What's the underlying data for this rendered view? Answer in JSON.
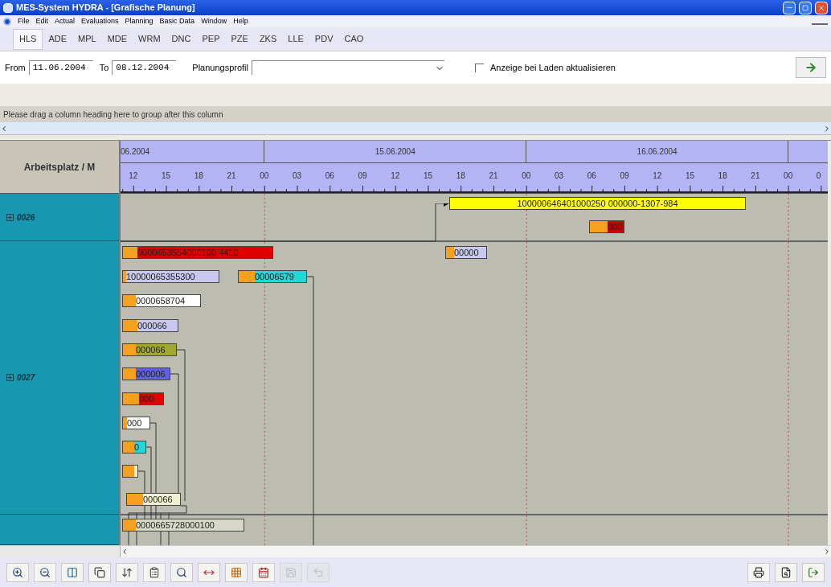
{
  "window": {
    "title": "MES-System HYDRA - [Grafische Planung]"
  },
  "menu": [
    "File",
    "Edit",
    "Actual",
    "Evaluations",
    "Planning",
    "Basic Data",
    "Window",
    "Help"
  ],
  "modules": [
    {
      "label": "HLS",
      "selected": true
    },
    {
      "label": "ADE",
      "selected": false
    },
    {
      "label": "MPL",
      "selected": false
    },
    {
      "label": "MDE",
      "selected": false
    },
    {
      "label": "WRM",
      "selected": false
    },
    {
      "label": "DNC",
      "selected": false
    },
    {
      "label": "PEP",
      "selected": false
    },
    {
      "label": "PZE",
      "selected": false
    },
    {
      "label": "ZKS",
      "selected": false
    },
    {
      "label": "LLE",
      "selected": false
    },
    {
      "label": "PDV",
      "selected": false
    },
    {
      "label": "CAO",
      "selected": false
    }
  ],
  "filter": {
    "from_label": "From",
    "from": "11.06.2004",
    "to_label": "To",
    "to": "08.12.2004",
    "profile_label": "Planungsprofil",
    "refresh": {
      "label": "Anzeige bei Laden aktualisieren",
      "checked": false
    }
  },
  "group_panel": "Please drag a column heading here to group after this column",
  "gantt": {
    "column_header": "Arbeitsplatz / M",
    "dates": [
      "06.2004",
      "15.06.2004",
      "16.06.2004"
    ],
    "hours": [
      "12",
      "15",
      "18",
      "21",
      "00",
      "03",
      "06",
      "09",
      "12",
      "15",
      "18",
      "21",
      "00",
      "03",
      "06",
      "09",
      "12",
      "15",
      "18",
      "21",
      "00",
      "0"
    ],
    "groups": [
      {
        "label": "0026",
        "expanded": false,
        "bars": [
          {
            "text": "100000646401000250 000000-1307-984",
            "color": "#ffff00"
          },
          {
            "text": "000",
            "color": "#cc0000"
          }
        ]
      },
      {
        "label": "0027",
        "expanded": false,
        "bars": [
          {
            "text": "0000653554000100 4410",
            "color": "#e00000"
          },
          {
            "text": "00000",
            "color": "#c8c8f0"
          },
          {
            "text": "10000065355300",
            "color": "#c8c8f0"
          },
          {
            "text": "00006579",
            "color": "#20d8d8"
          },
          {
            "text": "0000658704",
            "color": "#ffffff"
          },
          {
            "text": "000066",
            "color": "#c8c8f0"
          },
          {
            "text": "000066",
            "color": "#a0a830"
          },
          {
            "text": "000006",
            "color": "#6060e0"
          },
          {
            "text": "000",
            "color": "#e00000"
          },
          {
            "text": "000",
            "color": "#ffffff"
          },
          {
            "text": "0",
            "color": "#20d8d8"
          },
          {
            "color": "#f0f0d8"
          },
          {
            "text": "000066",
            "color": "#f0f0d0"
          }
        ]
      },
      {
        "bars": [
          {
            "text": "0000665728000100",
            "color": "#d8d8c8"
          }
        ]
      }
    ]
  },
  "toolbar": [
    {
      "kind": "zoom-in",
      "disabled": false
    },
    {
      "kind": "zoom-out",
      "disabled": false
    },
    {
      "kind": "fit",
      "disabled": false
    },
    {
      "kind": "copy",
      "disabled": false
    },
    {
      "kind": "move",
      "disabled": false
    },
    {
      "kind": "properties",
      "disabled": false
    },
    {
      "kind": "search",
      "disabled": false
    },
    {
      "kind": "spread",
      "disabled": false
    },
    {
      "kind": "grid",
      "disabled": false
    },
    {
      "kind": "calendar",
      "disabled": false
    },
    {
      "kind": "save",
      "disabled": true
    },
    {
      "kind": "undo",
      "disabled": true
    }
  ],
  "toolbar_right": [
    {
      "kind": "print",
      "disabled": false
    },
    {
      "kind": "preview",
      "disabled": false
    },
    {
      "kind": "exit",
      "disabled": false
    }
  ]
}
